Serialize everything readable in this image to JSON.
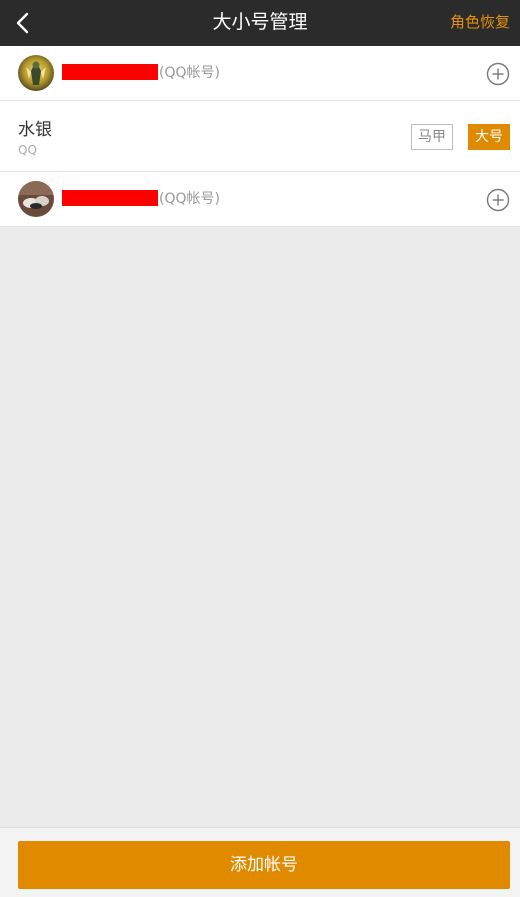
{
  "header": {
    "title": "大小号管理",
    "action_label": "角色恢复",
    "back_icon": "chevron-left-icon"
  },
  "accounts": [
    {
      "type_label": "(QQ帐号)",
      "add_icon": "plus-circle-icon"
    },
    {
      "type_label": "(QQ帐号)",
      "add_icon": "plus-circle-icon"
    }
  ],
  "role": {
    "name": "水银",
    "platform": "QQ",
    "tag_alt_label": "马甲",
    "tag_main_label": "大号"
  },
  "footer": {
    "add_account_label": "添加帐号"
  },
  "colors": {
    "header_bg": "#2b2b2b",
    "accent": "#e08a00",
    "background": "#ebebeb"
  }
}
